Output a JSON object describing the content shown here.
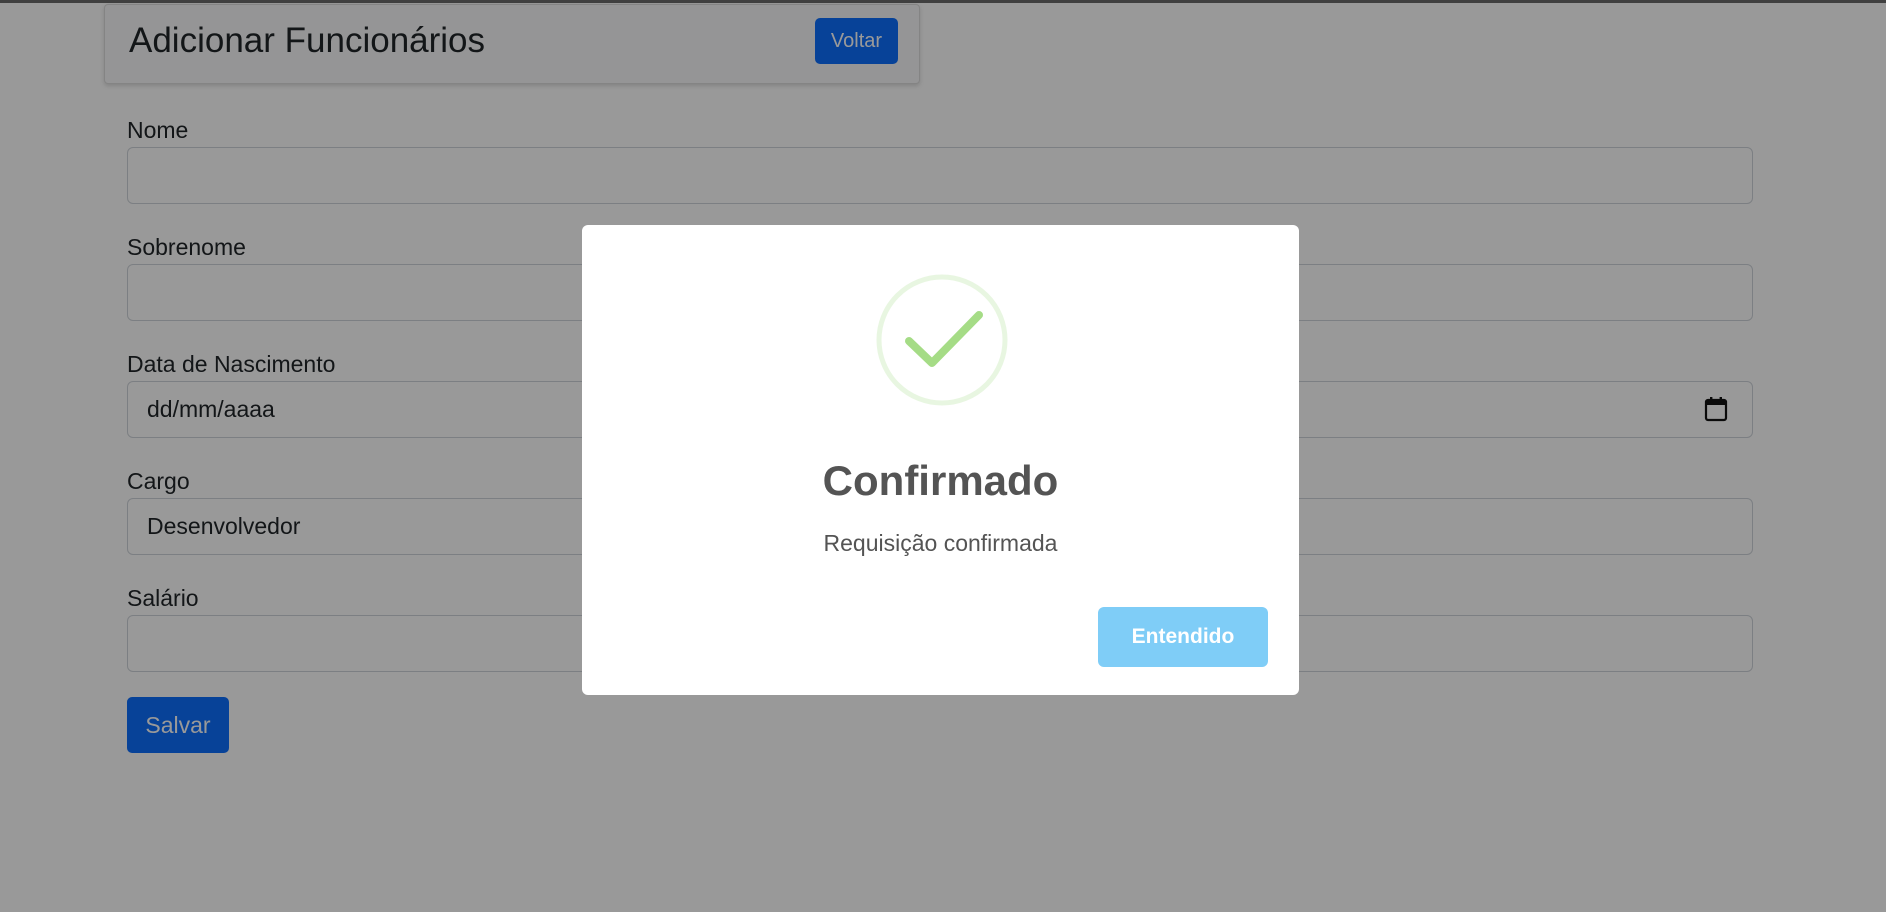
{
  "header": {
    "title": "Adicionar Funcionários",
    "back_label": "Voltar"
  },
  "form": {
    "fields": [
      {
        "label": "Nome",
        "value": ""
      },
      {
        "label": "Sobrenome",
        "value": ""
      },
      {
        "label": "Data de Nascimento",
        "value": "dd/mm/aaaa"
      },
      {
        "label": "Cargo",
        "value": "Desenvolvedor"
      },
      {
        "label": "Salário",
        "value": ""
      }
    ],
    "save_label": "Salvar"
  },
  "dialog": {
    "title": "Confirmado",
    "message": "Requisição confirmada",
    "confirm_label": "Entendido",
    "icon": "success-check-icon"
  },
  "colors": {
    "primary": "#0d6efd",
    "success": "#a5dc86",
    "confirm_button": "#7fcdf7",
    "overlay": "rgba(0,0,0,0.4)"
  }
}
